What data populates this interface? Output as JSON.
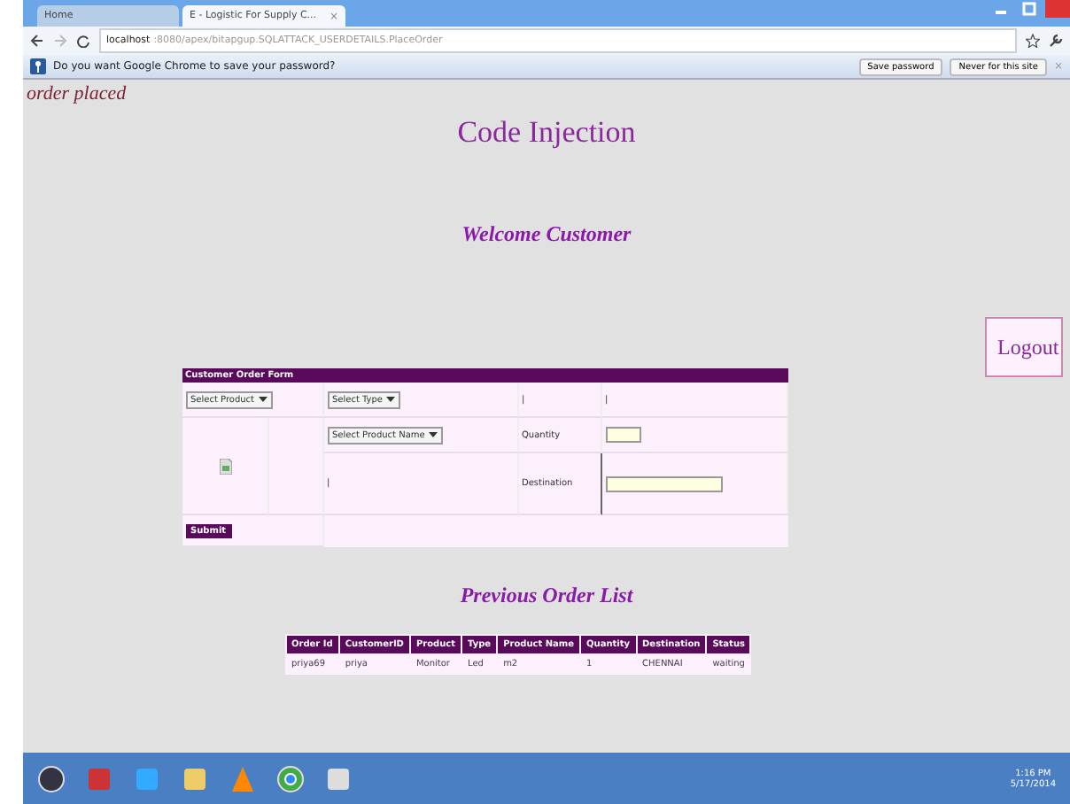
{
  "browser": {
    "tabs": [
      {
        "title": "Home",
        "selected": false
      },
      {
        "title": "E - Logistic For Supply C...",
        "selected": true,
        "close": "×"
      }
    ],
    "url": {
      "host": "localhost",
      "path": ":8080/apex/bitapgup.SQLATTACK_USERDETAILS.PlaceOrder"
    },
    "infobar": {
      "message": "Do you want Google Chrome to save your password?",
      "buttons": [
        "Save password",
        "Never for this site"
      ],
      "close": "×"
    }
  },
  "page": {
    "status": "order placed",
    "title": "Code Injection",
    "welcome": "Welcome Customer",
    "logout": "Logout",
    "form": {
      "heading": "Customer Order Form",
      "product_select": "Select Product",
      "type_select": "Select Type",
      "mark_1": "|",
      "mark_2": "|",
      "product_name_select": "Select Product Name",
      "quantity_label": "Quantity",
      "mark_3": "|",
      "destination_label": "Destination",
      "submit": "Submit"
    },
    "orders_title": "Previous Order List",
    "orders": {
      "columns": [
        "Order Id",
        "CustomerID",
        "Product",
        "Type",
        "Product Name",
        "Quantity",
        "Destination",
        "Status"
      ],
      "rows": [
        [
          "priya69",
          "priya",
          "Monitor",
          "Led",
          "m2",
          "1",
          "CHENNAI",
          "waiting"
        ]
      ]
    }
  },
  "taskbar": {
    "time": "1:16 PM",
    "date": "5/17/2014"
  }
}
